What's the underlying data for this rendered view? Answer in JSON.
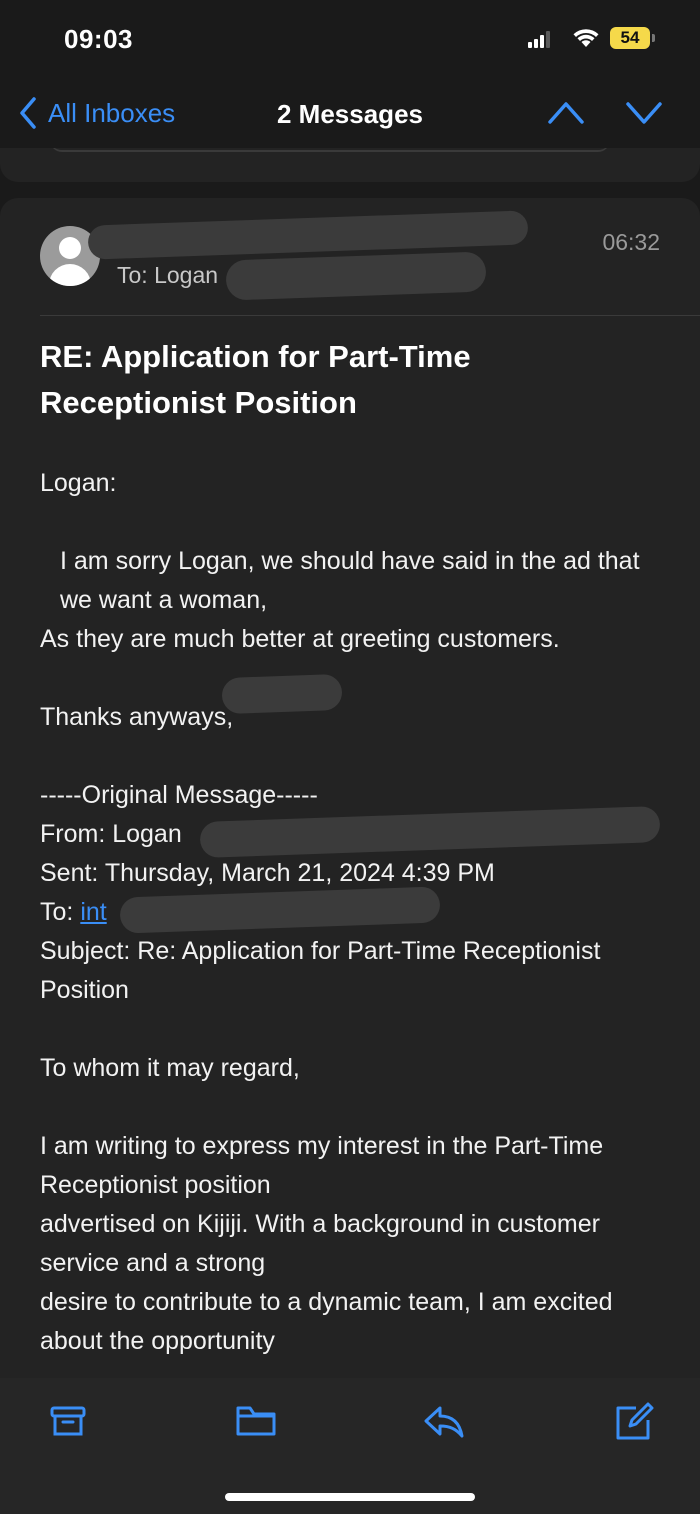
{
  "status_bar": {
    "time": "09:03",
    "battery": "54"
  },
  "nav": {
    "back_label": "All Inboxes",
    "title": "2 Messages",
    "accent_color": "#3a8ef6"
  },
  "message": {
    "to_label": "To: Logan",
    "time": "06:32",
    "subject": "RE: Application for Part-Time Receptionist Position",
    "greeting": "Logan:",
    "line1": "I am sorry Logan, we should have said in the ad that we want a woman,",
    "line2": "As they are much better at greeting customers.",
    "thanks": "Thanks anyways,",
    "original_header": "-----Original Message-----",
    "from": "From: Logan",
    "sent": "Sent: Thursday, March 21, 2024 4:39 PM",
    "to": "To:",
    "to_link": "int",
    "subject_line": "Subject: Re: Application for Part-Time Receptionist Position",
    "salutation": "To whom it may regard,",
    "para1": "I am writing to express my interest in the Part-Time Receptionist position",
    "para2": "advertised on Kijiji. With a background in customer service and a strong",
    "para3": "desire to contribute to a dynamic team, I am excited about the opportunity"
  },
  "toolbar": {
    "icons": [
      "archive-icon",
      "folder-icon",
      "reply-icon",
      "compose-icon"
    ]
  }
}
